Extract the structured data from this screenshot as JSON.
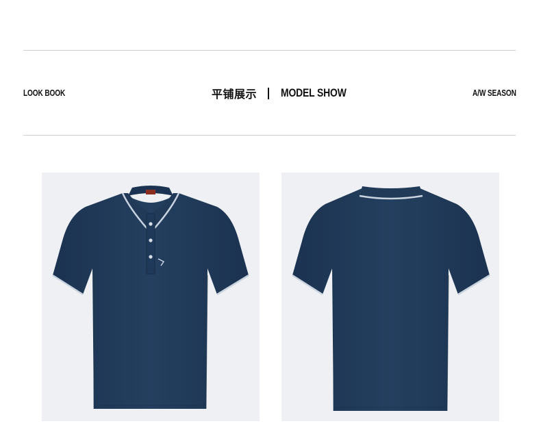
{
  "header": {
    "left_label": "LOOK BOOK",
    "title_cn": "平铺展示",
    "title_en": "MODEL SHOW",
    "right_label": "A/W SEASON"
  },
  "colors": {
    "shirt": "#213c5b",
    "collar_tipping": "#c9d3e0",
    "background": "#eef0f3",
    "rule": "#cfcfcf"
  },
  "photos": [
    {
      "view": "front"
    },
    {
      "view": "back"
    }
  ]
}
